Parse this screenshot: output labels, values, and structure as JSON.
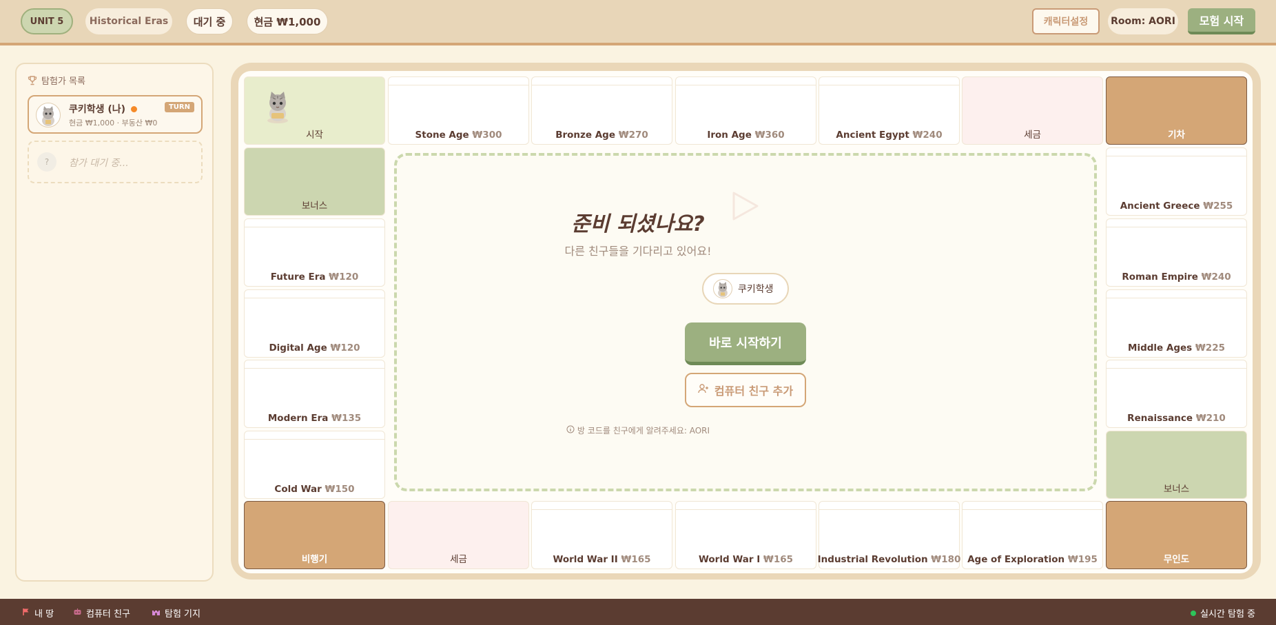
{
  "header": {
    "unit": "UNIT 5",
    "era_set": "Historical Eras",
    "status": "대기 중",
    "cash": "현금 ₩1,000",
    "character_settings": "캐릭터설정",
    "room": "Room: AORI",
    "start_adventure": "모험 시작"
  },
  "sidebar": {
    "title": "탐험가 목록",
    "player": {
      "name": "쿠키학생 (나)",
      "sub": "현금 ₩1,000 · 부동산 ₩0",
      "badge": "TURN"
    },
    "waiting": {
      "avatar": "?",
      "text": "참가 대기 중..."
    }
  },
  "board": {
    "tiles": [
      {
        "id": "t0",
        "name": "시작",
        "price": "",
        "kind": "start"
      },
      {
        "id": "t1",
        "name": "Stone Age",
        "price": "₩300",
        "kind": "property"
      },
      {
        "id": "t2",
        "name": "Bronze Age",
        "price": "₩270",
        "kind": "property"
      },
      {
        "id": "t3",
        "name": "Iron Age",
        "price": "₩360",
        "kind": "property"
      },
      {
        "id": "t4",
        "name": "Ancient Egypt",
        "price": "₩240",
        "kind": "property"
      },
      {
        "id": "t5",
        "name": "세금",
        "price": "",
        "kind": "tax"
      },
      {
        "id": "t6",
        "name": "기차",
        "price": "",
        "kind": "train"
      },
      {
        "id": "t7",
        "name": "Ancient Greece",
        "price": "₩255",
        "kind": "property"
      },
      {
        "id": "t8",
        "name": "Roman Empire",
        "price": "₩240",
        "kind": "property"
      },
      {
        "id": "t9",
        "name": "Middle Ages",
        "price": "₩225",
        "kind": "property"
      },
      {
        "id": "t10",
        "name": "Renaissance",
        "price": "₩210",
        "kind": "property"
      },
      {
        "id": "t11",
        "name": "보너스",
        "price": "",
        "kind": "bonus"
      },
      {
        "id": "t12",
        "name": "무인도",
        "price": "",
        "kind": "island"
      },
      {
        "id": "t13",
        "name": "Age of Exploration",
        "price": "₩195",
        "kind": "property"
      },
      {
        "id": "t14",
        "name": "Industrial Revolution",
        "price": "₩180",
        "kind": "property"
      },
      {
        "id": "t15",
        "name": "World War I",
        "price": "₩165",
        "kind": "property"
      },
      {
        "id": "t16",
        "name": "World War II",
        "price": "₩165",
        "kind": "property"
      },
      {
        "id": "t17",
        "name": "세금",
        "price": "",
        "kind": "tax"
      },
      {
        "id": "t18",
        "name": "비행기",
        "price": "",
        "kind": "plane"
      },
      {
        "id": "t19",
        "name": "Cold War",
        "price": "₩150",
        "kind": "property"
      },
      {
        "id": "t20",
        "name": "Modern Era",
        "price": "₩135",
        "kind": "property"
      },
      {
        "id": "t21",
        "name": "Digital Age",
        "price": "₩120",
        "kind": "property"
      },
      {
        "id": "t22",
        "name": "Future Era",
        "price": "₩120",
        "kind": "property"
      },
      {
        "id": "t23",
        "name": "보너스",
        "price": "",
        "kind": "bonus"
      }
    ]
  },
  "center": {
    "title": "준비 되셨나요?",
    "subtitle": "다른 친구들을 기다리고 있어요!",
    "player_chip": "쿠키학생",
    "start_now": "바로 시작하기",
    "add_bot": "컴퓨터 친구 추가",
    "note": "방 코드를 친구에게 알려주세요: AORI"
  },
  "footer": {
    "my_land": "내 땅",
    "bot_friends": "컴퓨터 친구",
    "base": "탐험 기지",
    "live": "실시간 탐험 중"
  },
  "colors": {
    "accent_green": "#9cb080",
    "accent_tan": "#d4a676",
    "brown": "#5b3c31",
    "turn_dot": "#f58a28",
    "live_dot": "#2ec45a"
  },
  "icons": {
    "sidebar_title": "trophy-icon",
    "center": "play-icon",
    "note": "info-icon",
    "add_bot": "user-plus-icon",
    "footer_my_land": "flag-icon",
    "footer_bot": "robot-icon",
    "footer_base": "castle-icon"
  }
}
